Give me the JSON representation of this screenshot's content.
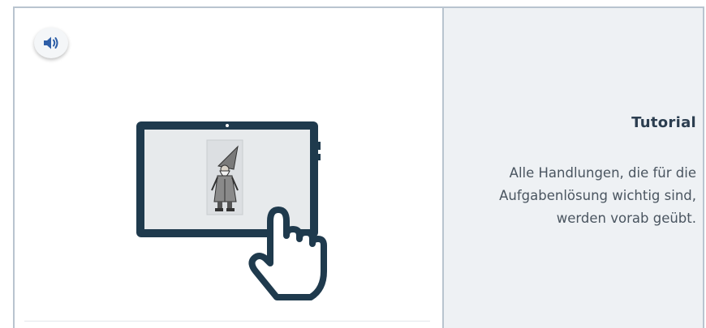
{
  "audio_button": {
    "icon": "speaker-icon"
  },
  "illustration": {
    "icons": [
      "tablet-icon",
      "gnome-figure",
      "pointing-hand-icon"
    ]
  },
  "tutorial": {
    "title": "Tutorial",
    "lines": [
      "Alle Handlungen, die für die",
      "Aufgabenlösung wichtig sind,",
      "werden vorab geübt."
    ]
  },
  "colors": {
    "border": "#b9c4cf",
    "panel_bg": "#eef1f4",
    "tablet_frame": "#1f3a4d",
    "title_text": "#2c3e50",
    "body_text": "#4a5560"
  }
}
